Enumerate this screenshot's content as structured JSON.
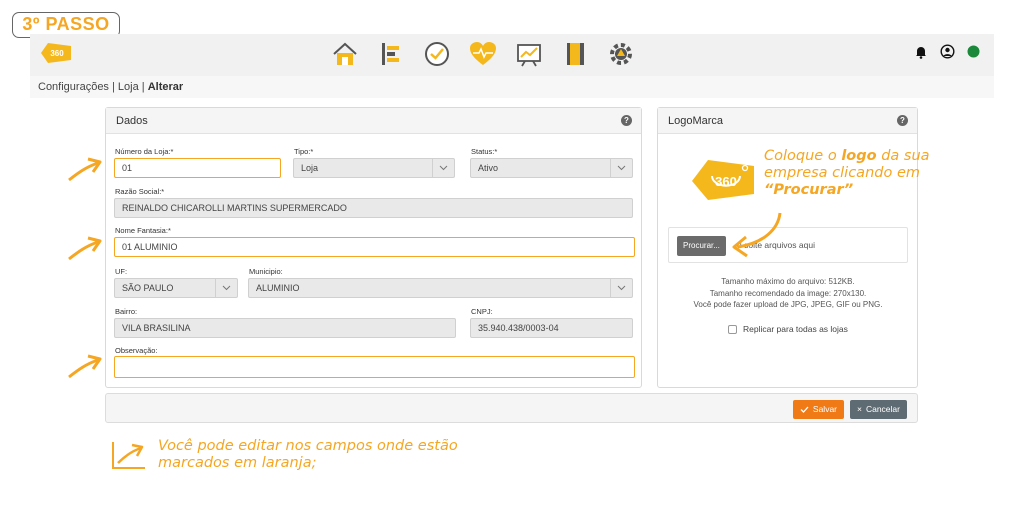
{
  "step_badge": "3º PASSO",
  "breadcrumb": {
    "part1": "Configurações",
    "sep": " | ",
    "part2": "Loja",
    "current": "Alterar"
  },
  "dados": {
    "title": "Dados",
    "numero_loja": {
      "label": "Número da Loja:*",
      "value": "01"
    },
    "tipo": {
      "label": "Tipo:*",
      "value": "Loja"
    },
    "status": {
      "label": "Status:*",
      "value": "Ativo"
    },
    "razao_social": {
      "label": "Razão Social:*",
      "value": "REINALDO CHICAROLLI MARTINS SUPERMERCADO"
    },
    "nome_fantasia": {
      "label": "Nome Fantasia:*",
      "value": "01 ALUMINIO"
    },
    "uf": {
      "label": "UF:",
      "value": "SÃO PAULO"
    },
    "municipio": {
      "label": "Municipio:",
      "value": "ALUMINIO"
    },
    "bairro": {
      "label": "Bairro:",
      "value": "VILA BRASILINA"
    },
    "cnpj": {
      "label": "CNPJ:",
      "value": "35.940.438/0003-04"
    },
    "observacao": {
      "label": "Observação:",
      "value": ""
    }
  },
  "logomarca": {
    "title": "LogoMarca",
    "procurar_label": "Procurar...",
    "drop_text": "u solte arquivos aqui",
    "info_1": "Tamanho máximo do arquivo: 512KB.",
    "info_2": "Tamanho recomendado da image: 270x130.",
    "info_3": "Você pode fazer upload de JPG, JPEG, GIF ou PNG.",
    "replicar_label": "Replicar para todas as lojas"
  },
  "logo_tip": {
    "part1": "Coloque o ",
    "bold": "logo",
    "part2": " da sua empresa clicando em ",
    "quoted": "“Procurar”"
  },
  "actions": {
    "salvar": "Salvar",
    "cancelar": "Cancelar"
  },
  "bottom_tip": "Você pode editar nos campos onde estão marcados em laranja;",
  "colors": {
    "accent": "#f5a623",
    "salvar": "#f07b16",
    "status_online": "#1a8a3a"
  },
  "icons": {
    "nav": [
      "home-icon",
      "list-icon",
      "check-circle-icon",
      "heart-pulse-icon",
      "chart-board-icon",
      "notebook-icon",
      "gear-icon"
    ],
    "right": [
      "bell-icon",
      "user-circle-icon",
      "status-dot-icon"
    ]
  }
}
